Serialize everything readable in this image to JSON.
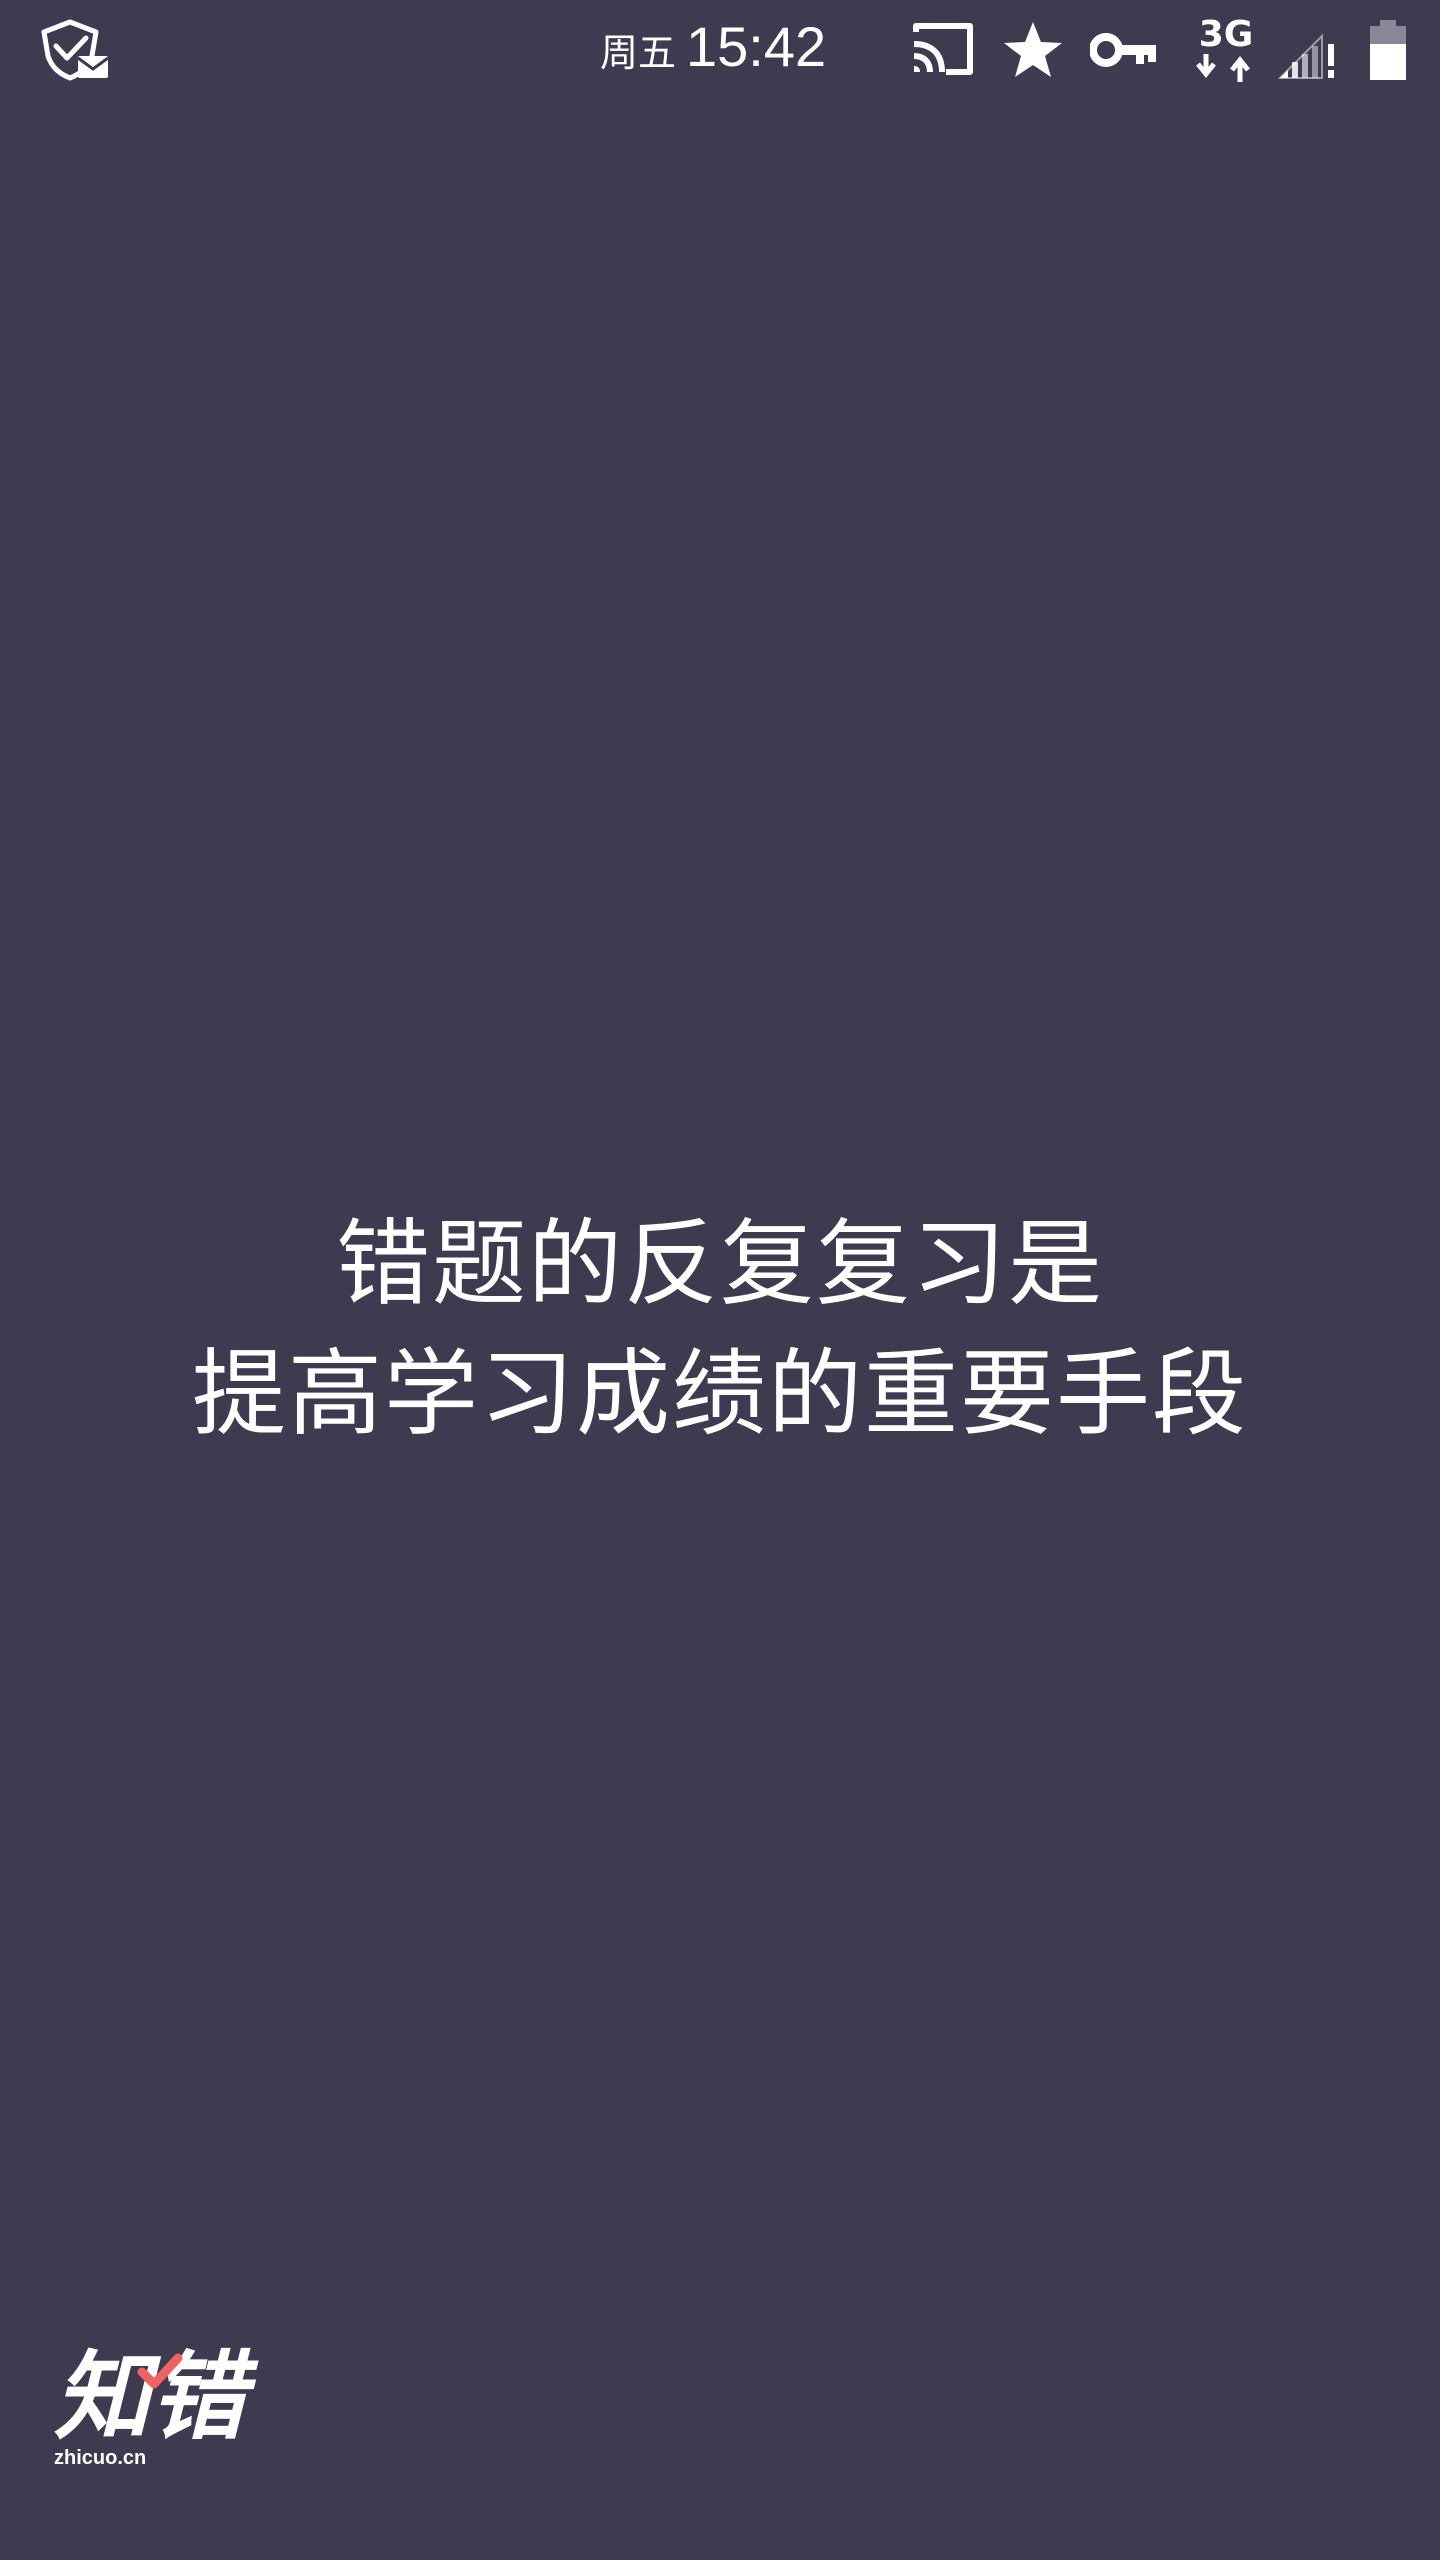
{
  "status_bar": {
    "day": "周五",
    "time": "15:42",
    "network_label": "3G",
    "icons": [
      "mail-notification-icon",
      "cast-icon",
      "star-icon",
      "vpn-key-icon",
      "network-3g-icon",
      "signal-icon",
      "battery-icon"
    ]
  },
  "splash": {
    "line1": "错题的反复复习是",
    "line2": "提高学习成绩的重要手段"
  },
  "brand": {
    "logo_text": "知错",
    "domain": "zhicuo.cn",
    "accent_color": "#f06262"
  },
  "colors": {
    "background": "#3e3b50",
    "text": "#ffffff"
  }
}
